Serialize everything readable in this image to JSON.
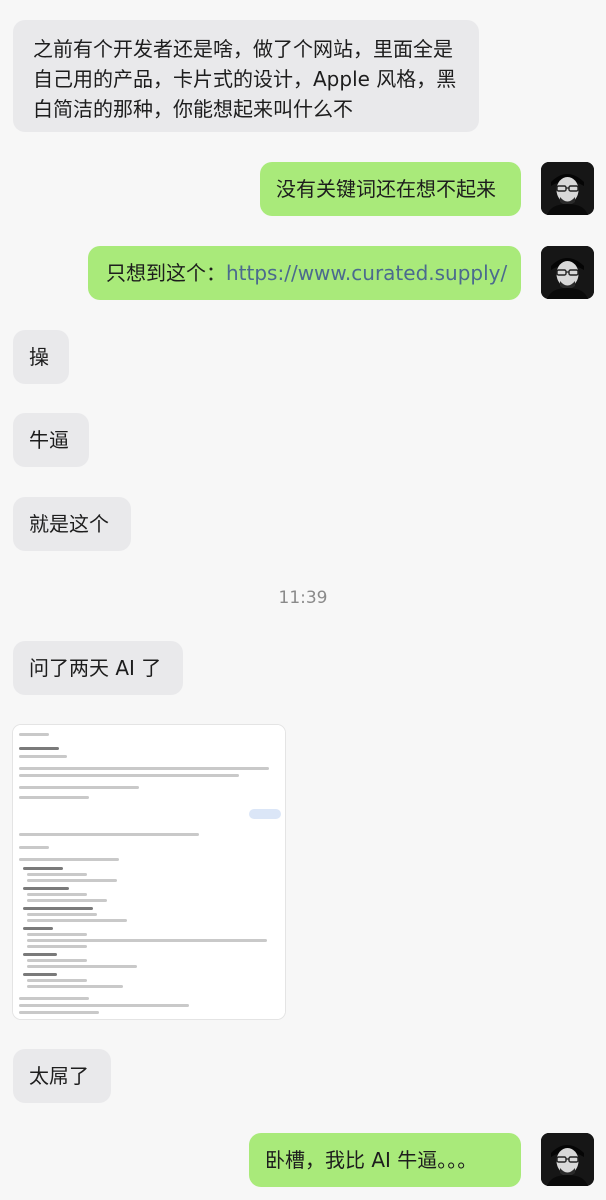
{
  "messages": {
    "m1_line1": "之前有个开发者还是啥，做了个网站，里面全是",
    "m1_line2": "自己用的产品，卡片式的设计，Apple 风格，黑",
    "m1_line3": "白简洁的那种，你能想起来叫什么不",
    "m2": "没有关键词还在想不起来",
    "m3_prefix": "只想到这个：",
    "m3_link": "https://www.curated.supply/",
    "m4": "操",
    "m5": "牛逼",
    "m6": "就是这个",
    "m7": "问了两天 AI 了",
    "m8": "太屌了",
    "m9": "卧槽，我比 AI 牛逼。。。"
  },
  "timestamp": "11:39",
  "colors": {
    "incoming_bubble": "#e9e9eb",
    "outgoing_bubble": "#a9ea7a",
    "link": "#4b6a8e",
    "background": "#f7f7f7"
  },
  "icons": {
    "avatar": "user-avatar-portrait"
  }
}
